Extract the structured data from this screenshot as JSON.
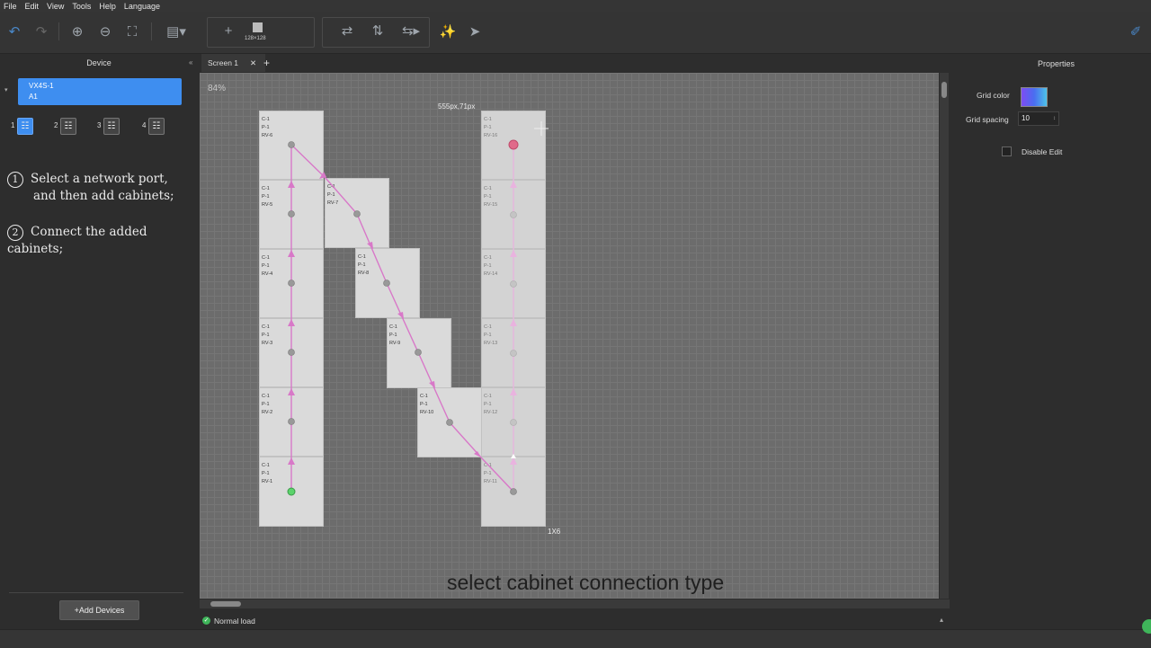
{
  "menu": [
    "File",
    "Edit",
    "View",
    "Tools",
    "Help",
    "Language"
  ],
  "toolbar": {
    "icons": [
      "undo-icon",
      "redo-icon",
      "zoom-in-icon",
      "zoom-out-icon",
      "fit-screen-icon",
      "layout-dropdown-icon",
      "add-cabinet-icon",
      "swap-horizontal-icon",
      "swap-vertical-icon",
      "swap-dropdown-icon",
      "magic-wand-icon",
      "send-icon",
      "eyedropper-icon"
    ],
    "cabinet_size": "128×128"
  },
  "left_panel": {
    "title": "Device",
    "device": {
      "name": "VX4S-1",
      "sub": "A1"
    },
    "ports": [
      "1",
      "2",
      "3",
      "4"
    ],
    "instructions": [
      {
        "num": "1",
        "text": "Select a network port,",
        "text2": "and then add cabinets;"
      },
      {
        "num": "2",
        "text": "Connect the added cabinets;"
      }
    ],
    "add_button": "Add Devices"
  },
  "tabs": {
    "screen": "Screen 1"
  },
  "canvas": {
    "zoom": "84%",
    "size_label": "555px,71px",
    "grid_label": "1X6",
    "subtitle": "select cabinet connection type",
    "cabinets": [
      {
        "c": "C-1",
        "p": "P-1",
        "rv": "RV-6"
      },
      {
        "c": "C-1",
        "p": "P-1",
        "rv": "RV-5"
      },
      {
        "c": "C-1",
        "p": "P-1",
        "rv": "RV-4"
      },
      {
        "c": "C-1",
        "p": "P-1",
        "rv": "RV-3"
      },
      {
        "c": "C-1",
        "p": "P-1",
        "rv": "RV-2"
      },
      {
        "c": "C-1",
        "p": "P-1",
        "rv": "RV-1"
      },
      {
        "c": "C-1",
        "p": "P-1",
        "rv": "RV-7"
      },
      {
        "c": "C-1",
        "p": "P-1",
        "rv": "RV-8"
      },
      {
        "c": "C-1",
        "p": "P-1",
        "rv": "RV-9"
      },
      {
        "c": "C-1",
        "p": "P-1",
        "rv": "RV-10"
      },
      {
        "c": "C-1",
        "p": "P-1",
        "rv": "RV-16"
      },
      {
        "c": "C-1",
        "p": "P-1",
        "rv": "RV-15"
      },
      {
        "c": "C-1",
        "p": "P-1",
        "rv": "RV-14"
      },
      {
        "c": "C-1",
        "p": "P-1",
        "rv": "RV-13"
      },
      {
        "c": "C-1",
        "p": "P-1",
        "rv": "RV-12"
      },
      {
        "c": "C-1",
        "p": "P-1",
        "rv": "RV-11"
      }
    ]
  },
  "status": {
    "text": "Normal load"
  },
  "properties": {
    "title": "Properties",
    "grid_color_label": "Grid color",
    "grid_spacing_label": "Grid spacing",
    "grid_spacing_value": "10",
    "disable_edit_label": "Disable Edit",
    "colors": {
      "accent": "#3e8ef0",
      "connector": "#d878c8",
      "grid_color_start": "#7d4df2",
      "grid_color_end": "#4cc2e8"
    }
  }
}
